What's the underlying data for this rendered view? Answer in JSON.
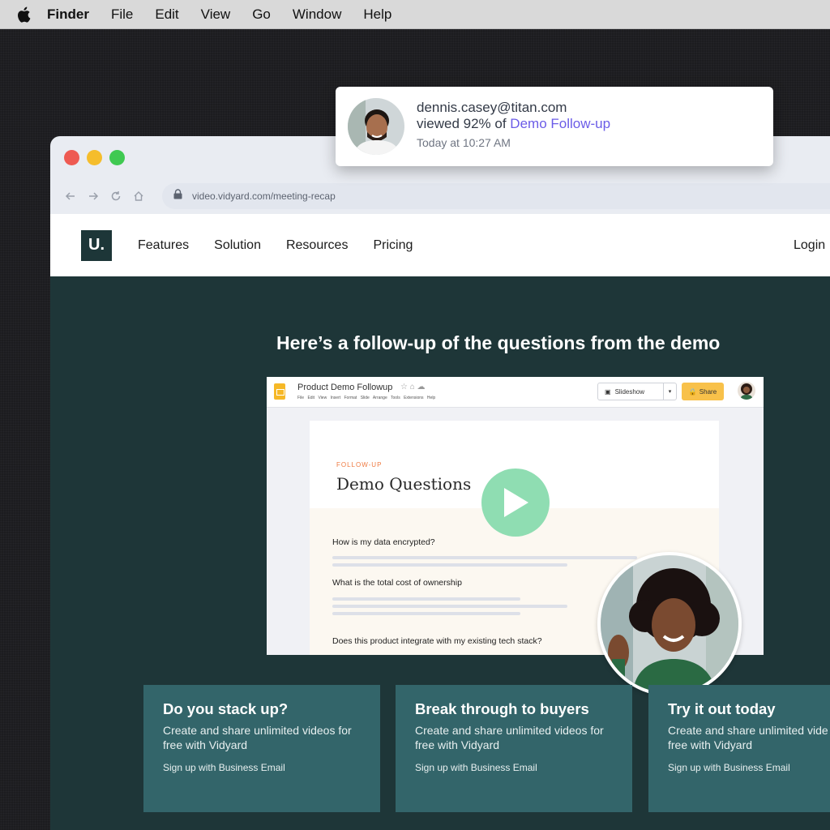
{
  "menubar": {
    "apple_icon": "apple-icon",
    "app": "Finder",
    "items": [
      "File",
      "Edit",
      "View",
      "Go",
      "Window",
      "Help"
    ]
  },
  "browser": {
    "url": "video.vidyard.com/meeting-recap",
    "nav_icons": [
      "back-arrow-icon",
      "forward-arrow-icon",
      "reload-icon",
      "home-icon",
      "lock-icon"
    ]
  },
  "site": {
    "logo": "U.",
    "nav": [
      "Features",
      "Solution",
      "Resources",
      "Pricing"
    ],
    "login": "Login",
    "hero_title": "Here’s a follow-up of the questions from the demo"
  },
  "slides": {
    "doc_title": "Product Demo Followup",
    "menu": "File Edit View Insert Format Slide Arrange Tools Extensions Help",
    "slideshow_label": "Slideshow",
    "share_label": "Share",
    "follow_up_label": "FOLLOW-UP",
    "heading": "Demo Questions",
    "questions": [
      "How is my data encrypted?",
      "What is the total cost of ownership",
      "Does this product integrate with my existing tech stack?"
    ]
  },
  "cards": [
    {
      "title": "Do you stack up?",
      "line1": "Create and share unlimited videos for",
      "line2": "free with Vidyard",
      "link": "Sign up with Business Email"
    },
    {
      "title": "Break through to buyers",
      "line1": "Create and share unlimited videos for",
      "line2": "free with Vidyard",
      "link": "Sign up with Business Email"
    },
    {
      "title": "Try it out today",
      "line1": "Create and share unlimited vide",
      "line2": "free with Vidyard",
      "link": "Sign up with Business Email"
    }
  ],
  "notification": {
    "email": "dennis.casey@titan.com",
    "viewed_prefix": "viewed 92% of ",
    "video_link": "Demo Follow-up",
    "time": "Today at 10:27 AM"
  },
  "colors": {
    "hero_bg": "#1e3638",
    "card_bg": "#33656a",
    "play_button": "#8fddb2",
    "link": "#6b5ce7",
    "accent_orange": "#ef7a41"
  }
}
